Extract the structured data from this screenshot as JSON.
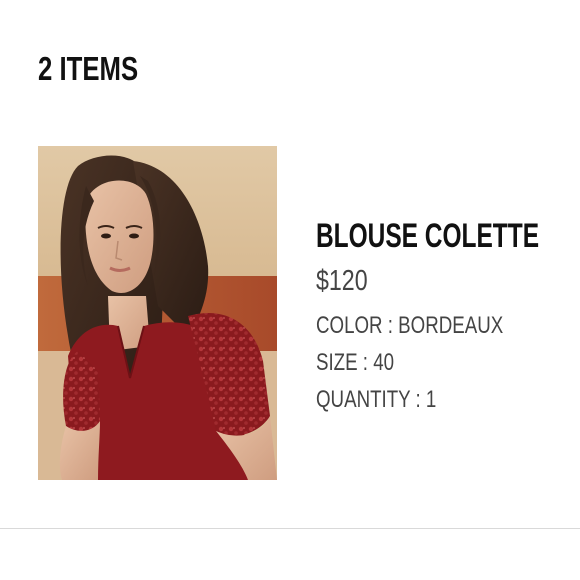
{
  "cart": {
    "items_count_label": "2 ITEMS"
  },
  "product": {
    "name": "BLOUSE COLETTE",
    "price": "$120",
    "color_line": "COLOR : BORDEAUX",
    "size_line": "SIZE : 40",
    "quantity_line": "QUANTITY : 1",
    "image_alt": "model wearing bordeaux lace-sleeve blouse",
    "colors": {
      "blouse": "#8e1a1f",
      "background_wall": "#d8bf9a",
      "background_lower": "#b5532e"
    }
  }
}
